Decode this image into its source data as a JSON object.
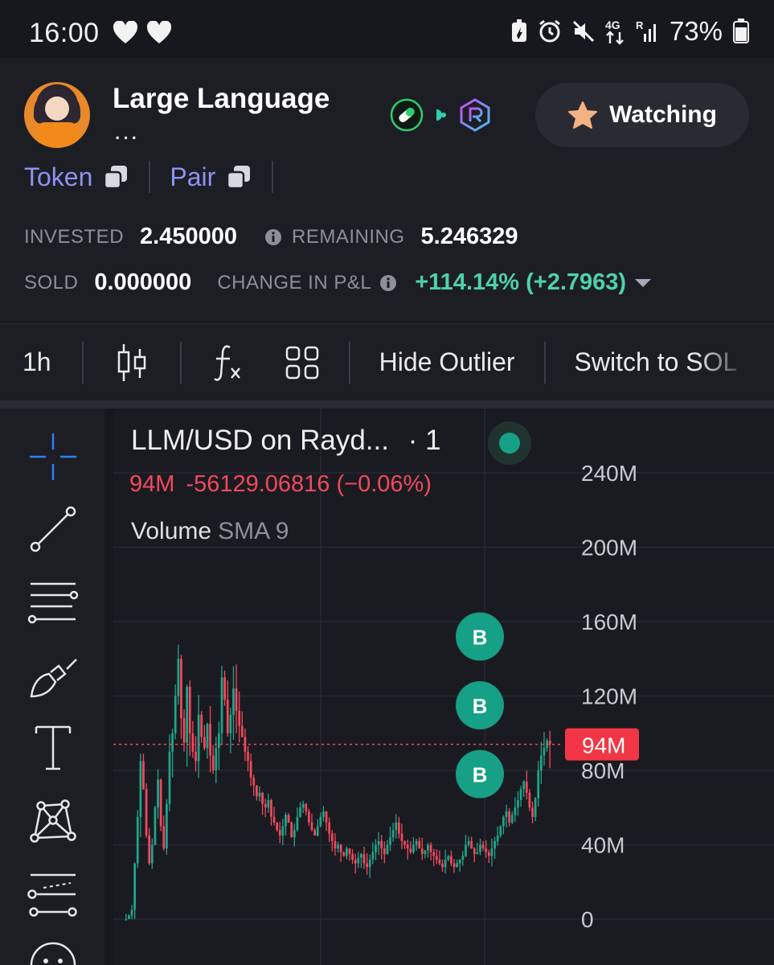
{
  "status_bar": {
    "time": "16:00",
    "network": "4G",
    "battery": "73%"
  },
  "header": {
    "title": "Large Language",
    "title_overflow": "...",
    "watch_label": "Watching",
    "links": [
      {
        "label": "Token"
      },
      {
        "label": "Pair"
      }
    ],
    "stats": {
      "invested_label": "INVESTED",
      "invested_value": "2.450000",
      "remaining_label": "REMAINING",
      "remaining_value": "5.246329",
      "sold_label": "SOLD",
      "sold_value": "0.000000",
      "pnl_label": "CHANGE IN P&L",
      "pnl_value": "+114.14% (+2.7963)"
    },
    "colors": {
      "accent_link": "#8e92f2",
      "positive": "#4fd1a8"
    }
  },
  "toolbar": {
    "interval": "1h",
    "hide_outlier": "Hide Outlier",
    "switch_to": "Switch to SOL"
  },
  "chart": {
    "title": "LLM/USD on Rayd...",
    "title_suffix": "· 1",
    "ohlc_value": "94M",
    "ohlc_change": "-56129.06816 (−0.06%)",
    "volume_label": "Volume",
    "volume_sub": "SMA 9",
    "price_tag": "94M",
    "buy_marker_label": "B"
  },
  "chart_data": {
    "type": "candlestick",
    "ylim": [
      0,
      240
    ],
    "y_unit": "M",
    "y_ticks": [
      "240M",
      "200M",
      "160M",
      "120M",
      "80M",
      "40M",
      "0"
    ],
    "y_tick_values": [
      240,
      200,
      160,
      120,
      80,
      40,
      0
    ],
    "current_price": 94,
    "buy_markers_at": [
      152,
      115,
      78
    ],
    "colors": {
      "up": "#21a58a",
      "down": "#f2495c",
      "grid": "#262832",
      "text": "#c9cad0"
    },
    "close_path": [
      0,
      2,
      5,
      30,
      55,
      85,
      70,
      45,
      30,
      40,
      60,
      75,
      50,
      38,
      62,
      90,
      100,
      120,
      140,
      108,
      95,
      125,
      100,
      90,
      85,
      110,
      98,
      92,
      105,
      88,
      80,
      92,
      100,
      130,
      118,
      100,
      110,
      124,
      112,
      104,
      98,
      90,
      85,
      76,
      72,
      66,
      68,
      62,
      60,
      64,
      55,
      52,
      48,
      45,
      50,
      56,
      52,
      44,
      48,
      55,
      60,
      62,
      58,
      52,
      48,
      45,
      50,
      55,
      58,
      52,
      46,
      42,
      38,
      40,
      36,
      34,
      38,
      35,
      32,
      30,
      33,
      35,
      30,
      28,
      32,
      36,
      40,
      42,
      38,
      35,
      40,
      44,
      48,
      52,
      46,
      42,
      40,
      38,
      36,
      40,
      42,
      38,
      35,
      37,
      40,
      36,
      34,
      32,
      30,
      28,
      32,
      34,
      30,
      28,
      30,
      32,
      34,
      40,
      42,
      38,
      35,
      36,
      40,
      38,
      36,
      34,
      38,
      42,
      45,
      50,
      55,
      58,
      52,
      56,
      60,
      64,
      70,
      74,
      68,
      60,
      55,
      65,
      80,
      88,
      92,
      96,
      94
    ]
  }
}
